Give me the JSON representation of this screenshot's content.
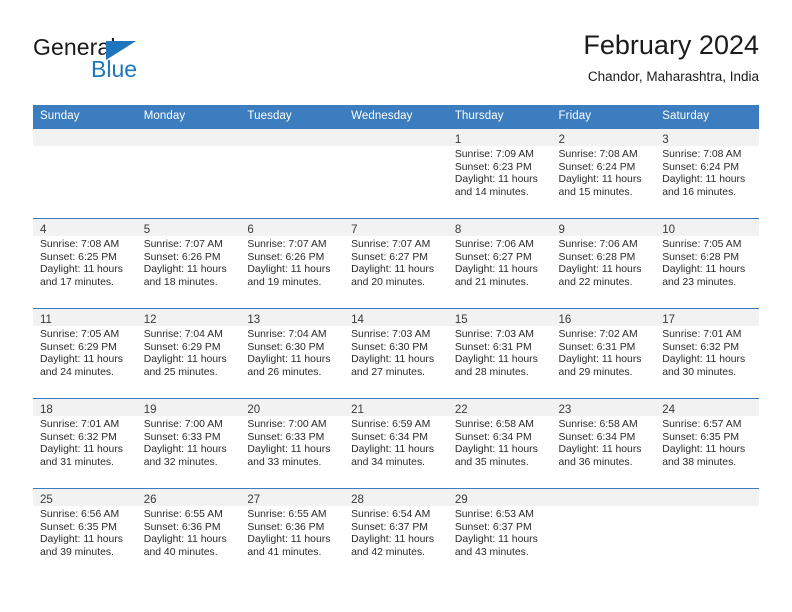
{
  "brand": {
    "word_top": "General",
    "word_bottom": "Blue",
    "accent_color": "#1f76bc"
  },
  "header": {
    "title": "February 2024",
    "subtitle": "Chandor, Maharashtra, India"
  },
  "calendar": {
    "header_bg": "#3b7dbf",
    "weekday_headers": [
      "Sunday",
      "Monday",
      "Tuesday",
      "Wednesday",
      "Thursday",
      "Friday",
      "Saturday"
    ],
    "weeks": [
      [
        {
          "day": "",
          "empty": true
        },
        {
          "day": "",
          "empty": true
        },
        {
          "day": "",
          "empty": true
        },
        {
          "day": "",
          "empty": true
        },
        {
          "day": "1",
          "sunrise": "Sunrise: 7:09 AM",
          "sunset": "Sunset: 6:23 PM",
          "daylight_1": "Daylight: 11 hours",
          "daylight_2": "and 14 minutes."
        },
        {
          "day": "2",
          "sunrise": "Sunrise: 7:08 AM",
          "sunset": "Sunset: 6:24 PM",
          "daylight_1": "Daylight: 11 hours",
          "daylight_2": "and 15 minutes."
        },
        {
          "day": "3",
          "sunrise": "Sunrise: 7:08 AM",
          "sunset": "Sunset: 6:24 PM",
          "daylight_1": "Daylight: 11 hours",
          "daylight_2": "and 16 minutes."
        }
      ],
      [
        {
          "day": "4",
          "sunrise": "Sunrise: 7:08 AM",
          "sunset": "Sunset: 6:25 PM",
          "daylight_1": "Daylight: 11 hours",
          "daylight_2": "and 17 minutes."
        },
        {
          "day": "5",
          "sunrise": "Sunrise: 7:07 AM",
          "sunset": "Sunset: 6:26 PM",
          "daylight_1": "Daylight: 11 hours",
          "daylight_2": "and 18 minutes."
        },
        {
          "day": "6",
          "sunrise": "Sunrise: 7:07 AM",
          "sunset": "Sunset: 6:26 PM",
          "daylight_1": "Daylight: 11 hours",
          "daylight_2": "and 19 minutes."
        },
        {
          "day": "7",
          "sunrise": "Sunrise: 7:07 AM",
          "sunset": "Sunset: 6:27 PM",
          "daylight_1": "Daylight: 11 hours",
          "daylight_2": "and 20 minutes."
        },
        {
          "day": "8",
          "sunrise": "Sunrise: 7:06 AM",
          "sunset": "Sunset: 6:27 PM",
          "daylight_1": "Daylight: 11 hours",
          "daylight_2": "and 21 minutes."
        },
        {
          "day": "9",
          "sunrise": "Sunrise: 7:06 AM",
          "sunset": "Sunset: 6:28 PM",
          "daylight_1": "Daylight: 11 hours",
          "daylight_2": "and 22 minutes."
        },
        {
          "day": "10",
          "sunrise": "Sunrise: 7:05 AM",
          "sunset": "Sunset: 6:28 PM",
          "daylight_1": "Daylight: 11 hours",
          "daylight_2": "and 23 minutes."
        }
      ],
      [
        {
          "day": "11",
          "sunrise": "Sunrise: 7:05 AM",
          "sunset": "Sunset: 6:29 PM",
          "daylight_1": "Daylight: 11 hours",
          "daylight_2": "and 24 minutes."
        },
        {
          "day": "12",
          "sunrise": "Sunrise: 7:04 AM",
          "sunset": "Sunset: 6:29 PM",
          "daylight_1": "Daylight: 11 hours",
          "daylight_2": "and 25 minutes."
        },
        {
          "day": "13",
          "sunrise": "Sunrise: 7:04 AM",
          "sunset": "Sunset: 6:30 PM",
          "daylight_1": "Daylight: 11 hours",
          "daylight_2": "and 26 minutes."
        },
        {
          "day": "14",
          "sunrise": "Sunrise: 7:03 AM",
          "sunset": "Sunset: 6:30 PM",
          "daylight_1": "Daylight: 11 hours",
          "daylight_2": "and 27 minutes."
        },
        {
          "day": "15",
          "sunrise": "Sunrise: 7:03 AM",
          "sunset": "Sunset: 6:31 PM",
          "daylight_1": "Daylight: 11 hours",
          "daylight_2": "and 28 minutes."
        },
        {
          "day": "16",
          "sunrise": "Sunrise: 7:02 AM",
          "sunset": "Sunset: 6:31 PM",
          "daylight_1": "Daylight: 11 hours",
          "daylight_2": "and 29 minutes."
        },
        {
          "day": "17",
          "sunrise": "Sunrise: 7:01 AM",
          "sunset": "Sunset: 6:32 PM",
          "daylight_1": "Daylight: 11 hours",
          "daylight_2": "and 30 minutes."
        }
      ],
      [
        {
          "day": "18",
          "sunrise": "Sunrise: 7:01 AM",
          "sunset": "Sunset: 6:32 PM",
          "daylight_1": "Daylight: 11 hours",
          "daylight_2": "and 31 minutes."
        },
        {
          "day": "19",
          "sunrise": "Sunrise: 7:00 AM",
          "sunset": "Sunset: 6:33 PM",
          "daylight_1": "Daylight: 11 hours",
          "daylight_2": "and 32 minutes."
        },
        {
          "day": "20",
          "sunrise": "Sunrise: 7:00 AM",
          "sunset": "Sunset: 6:33 PM",
          "daylight_1": "Daylight: 11 hours",
          "daylight_2": "and 33 minutes."
        },
        {
          "day": "21",
          "sunrise": "Sunrise: 6:59 AM",
          "sunset": "Sunset: 6:34 PM",
          "daylight_1": "Daylight: 11 hours",
          "daylight_2": "and 34 minutes."
        },
        {
          "day": "22",
          "sunrise": "Sunrise: 6:58 AM",
          "sunset": "Sunset: 6:34 PM",
          "daylight_1": "Daylight: 11 hours",
          "daylight_2": "and 35 minutes."
        },
        {
          "day": "23",
          "sunrise": "Sunrise: 6:58 AM",
          "sunset": "Sunset: 6:34 PM",
          "daylight_1": "Daylight: 11 hours",
          "daylight_2": "and 36 minutes."
        },
        {
          "day": "24",
          "sunrise": "Sunrise: 6:57 AM",
          "sunset": "Sunset: 6:35 PM",
          "daylight_1": "Daylight: 11 hours",
          "daylight_2": "and 38 minutes."
        }
      ],
      [
        {
          "day": "25",
          "sunrise": "Sunrise: 6:56 AM",
          "sunset": "Sunset: 6:35 PM",
          "daylight_1": "Daylight: 11 hours",
          "daylight_2": "and 39 minutes."
        },
        {
          "day": "26",
          "sunrise": "Sunrise: 6:55 AM",
          "sunset": "Sunset: 6:36 PM",
          "daylight_1": "Daylight: 11 hours",
          "daylight_2": "and 40 minutes."
        },
        {
          "day": "27",
          "sunrise": "Sunrise: 6:55 AM",
          "sunset": "Sunset: 6:36 PM",
          "daylight_1": "Daylight: 11 hours",
          "daylight_2": "and 41 minutes."
        },
        {
          "day": "28",
          "sunrise": "Sunrise: 6:54 AM",
          "sunset": "Sunset: 6:37 PM",
          "daylight_1": "Daylight: 11 hours",
          "daylight_2": "and 42 minutes."
        },
        {
          "day": "29",
          "sunrise": "Sunrise: 6:53 AM",
          "sunset": "Sunset: 6:37 PM",
          "daylight_1": "Daylight: 11 hours",
          "daylight_2": "and 43 minutes."
        },
        {
          "day": "",
          "empty": true
        },
        {
          "day": "",
          "empty": true
        }
      ]
    ]
  }
}
